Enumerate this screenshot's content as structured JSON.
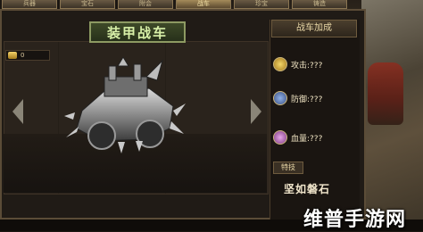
{
  "tabs": [
    "兵器",
    "宝石",
    "附会",
    "战车",
    "珍宝",
    "铸造"
  ],
  "active_tab_index": 3,
  "title": "装甲战车",
  "resource_value": "0",
  "side_header": "战车加成",
  "stats": {
    "attack": "攻击:???",
    "defense": "防御:???",
    "hp": "血量:???"
  },
  "skill": {
    "label": "特技",
    "name": "坚如磐石"
  },
  "watermark": "维普手游网",
  "colors": {
    "title_text": "#d8f0a8",
    "panel_border": "#5b4c37",
    "accent_gold": "#e9d7a6"
  },
  "icons": [
    "resource-coin-icon",
    "attack-icon",
    "defense-icon",
    "hp-icon",
    "left-arrow-icon",
    "right-arrow-icon"
  ]
}
